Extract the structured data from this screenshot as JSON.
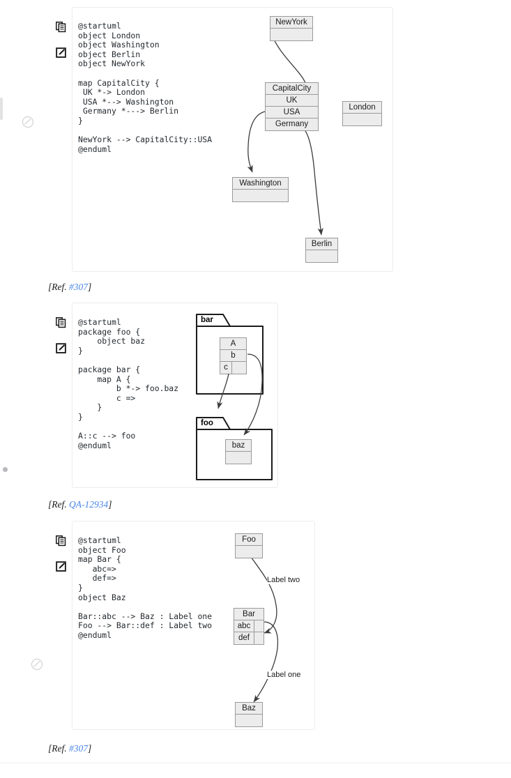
{
  "page": {
    "background": "#ffffff",
    "link_color": "#4a86e8",
    "scrollbar_thumb_color": "#e2e2e2",
    "bullet_dot_color": "#b8b8bd"
  },
  "icons": {
    "copy": "copy-icon",
    "edit": "edit-icon",
    "theme": "theme-toggle-icon"
  },
  "examples": [
    {
      "id": "example-1",
      "code": "@startuml\nobject London\nobject Washington\nobject Berlin\nobject NewYork\n\nmap CapitalCity {\n UK *-> London\n USA *--> Washington\n Germany *---> Berlin\n}\n\nNewYork --> CapitalCity::USA\n@enduml",
      "ref_prefix": "[Ref. ",
      "ref_link": "#307",
      "ref_suffix": "]",
      "diagram": {
        "type": "object-map-diagram",
        "nodes": [
          {
            "name": "NewYork",
            "kind": "object",
            "title": "NewYork"
          },
          {
            "name": "CapitalCity",
            "kind": "map",
            "title": "CapitalCity",
            "entries": [
              {
                "key": "UK"
              },
              {
                "key": "USA"
              },
              {
                "key": "Germany"
              }
            ]
          },
          {
            "name": "London",
            "kind": "object",
            "title": "London"
          },
          {
            "name": "Washington",
            "kind": "object",
            "title": "Washington"
          },
          {
            "name": "Berlin",
            "kind": "object",
            "title": "Berlin"
          }
        ],
        "edges": [
          {
            "from": "NewYork",
            "to": "CapitalCity::USA",
            "label": ""
          },
          {
            "from": "CapitalCity::UK",
            "to": "London",
            "label": ""
          },
          {
            "from": "CapitalCity::USA",
            "to": "Washington",
            "label": ""
          },
          {
            "from": "CapitalCity::Germany",
            "to": "Berlin",
            "label": ""
          }
        ]
      }
    },
    {
      "id": "example-2",
      "code": "@startuml\npackage foo {\n    object baz\n}\n\npackage bar {\n    map A {\n        b *-> foo.baz\n        c =>\n    }\n}\n\nA::c --> foo\n@enduml",
      "ref_prefix": "[Ref. ",
      "ref_link": "QA-12934",
      "ref_suffix": "]",
      "diagram": {
        "type": "package-map-diagram",
        "packages": [
          {
            "name": "bar",
            "label": "bar"
          },
          {
            "name": "foo",
            "label": "foo"
          }
        ],
        "nodes": [
          {
            "name": "A",
            "kind": "map",
            "title": "A",
            "entries": [
              {
                "key": "b"
              },
              {
                "key": "c"
              }
            ]
          },
          {
            "name": "baz",
            "kind": "object",
            "title": "baz"
          }
        ],
        "edges": [
          {
            "from": "A::b",
            "to": "baz",
            "label": ""
          },
          {
            "from": "A::c",
            "to": "foo",
            "label": ""
          }
        ]
      }
    },
    {
      "id": "example-3",
      "code": "@startuml\nobject Foo\nmap Bar {\n   abc=>\n   def=>\n}\nobject Baz\n\nBar::abc --> Baz : Label one\nFoo --> Bar::def : Label two\n@enduml",
      "ref_prefix": "[Ref. ",
      "ref_link": "#307",
      "ref_suffix": "]",
      "diagram": {
        "type": "object-map-diagram",
        "nodes": [
          {
            "name": "Foo",
            "kind": "object",
            "title": "Foo"
          },
          {
            "name": "Bar",
            "kind": "map",
            "title": "Bar",
            "entries": [
              {
                "key": "abc"
              },
              {
                "key": "def"
              }
            ]
          },
          {
            "name": "Baz",
            "kind": "object",
            "title": "Baz"
          }
        ],
        "edges": [
          {
            "from": "Foo",
            "to": "Bar::def",
            "label": "Label two"
          },
          {
            "from": "Bar::abc",
            "to": "Baz",
            "label": "Label one"
          }
        ]
      }
    }
  ]
}
